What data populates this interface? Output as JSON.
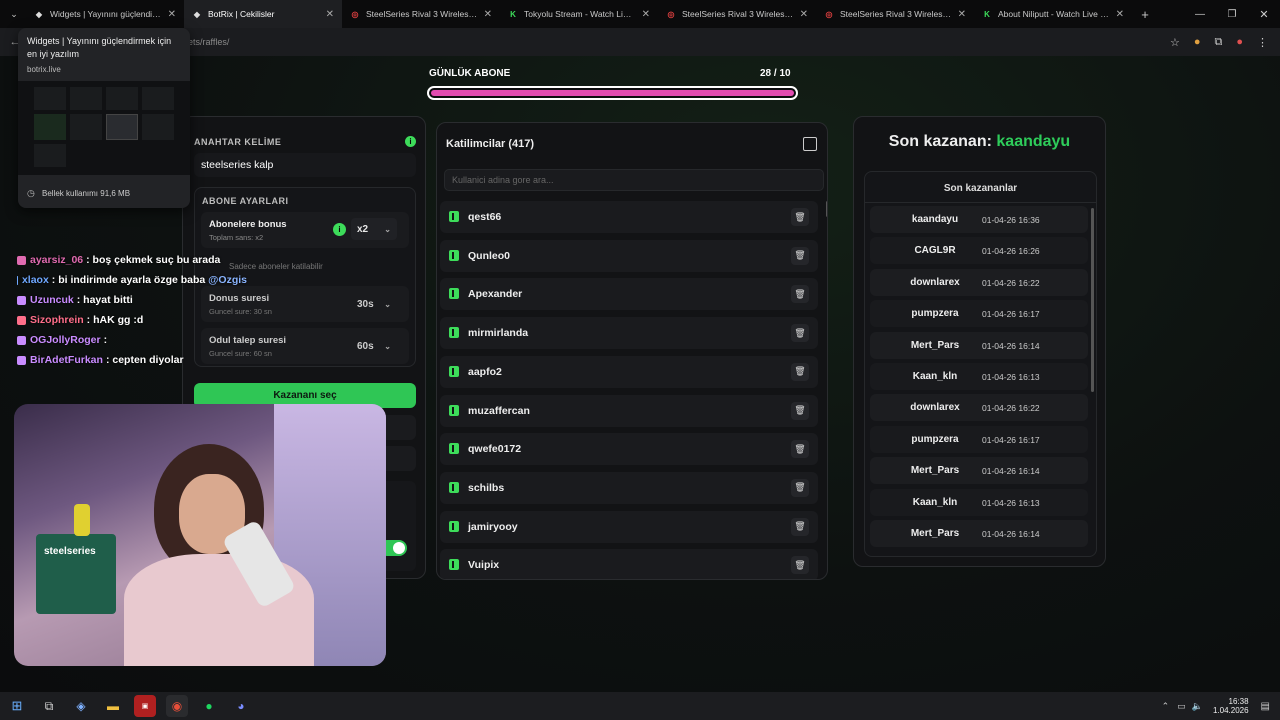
{
  "browser": {
    "tabs": [
      {
        "title": "Widgets | Yayınını güçlendirmek",
        "icon": "botrix-icon",
        "active": false
      },
      {
        "title": "BotRix | Cekilisler",
        "icon": "botrix-icon",
        "active": true
      },
      {
        "title": "SteelSeries Rival 3 Wireless Gen",
        "icon": "steelseries-icon",
        "active": false
      },
      {
        "title": "Tokyolu Stream - Watch Live on",
        "icon": "kick-icon",
        "active": false
      },
      {
        "title": "SteelSeries Rival 3 Wireless Gen",
        "icon": "steelseries-icon",
        "active": false
      },
      {
        "title": "SteelSeries Rival 3 Wireless Gen",
        "icon": "steelseries-icon",
        "active": false
      },
      {
        "title": "About Niliputt - Watch Live on",
        "icon": "kick-icon",
        "active": false
      }
    ],
    "url_visible": "ets/raffles/",
    "tooltip": {
      "title": "Widgets | Yayınını güçlendirmek için en iyi yazılım",
      "domain": "botrix.live",
      "memory": "Bellek kullanımı 91,6 MB"
    }
  },
  "goal": {
    "label": "GÜNLÜK ABONE",
    "count": "28 / 10",
    "progress": 1.0
  },
  "settings": {
    "keyword_label": "ANAHTAR KELİME",
    "keyword_value": "steelseries kalp",
    "sub_settings_label": "ABONE AYARLARI",
    "sub_bonus_label": "Abonelere bonus",
    "sub_bonus_sub": "Toplam sans: x2",
    "sub_bonus_value": "x2",
    "subs_only_label": "Sadece aboneler katilabilir",
    "bonus_time_label": "Donus suresi",
    "bonus_time_sub": "Guncel sure: 30 sn",
    "bonus_time_value": "30s",
    "claim_time_label": "Odul talep suresi",
    "claim_time_sub": "Guncel sure: 60 sn",
    "claim_time_value": "60s",
    "pick_winner_button": "Kazananı seç"
  },
  "participants": {
    "title": "Katilimcilar (417)",
    "search_placeholder": "Kullanici adina gore ara...",
    "items": [
      "qest66",
      "Qunleo0",
      "Apexander",
      "mirmirlanda",
      "aapfo2",
      "muzaffercan",
      "qwefe0172",
      "schilbs",
      "jamiryooy",
      "Vuipix"
    ]
  },
  "winners": {
    "last_winner_prefix": "Son kazanan:",
    "last_winner_name": "kaandayu",
    "list_title": "Son kazananlar",
    "items": [
      {
        "name": "kaandayu",
        "time": "01-04-26 16:36"
      },
      {
        "name": "CAGL9R",
        "time": "01-04-26 16:26"
      },
      {
        "name": "downlarex",
        "time": "01-04-26 16:22"
      },
      {
        "name": "pumpzera",
        "time": "01-04-26 16:17"
      },
      {
        "name": "Mert_Pars",
        "time": "01-04-26 16:14"
      },
      {
        "name": "Kaan_kln",
        "time": "01-04-26 16:13"
      },
      {
        "name": "downlarex",
        "time": "01-04-26 16:22"
      },
      {
        "name": "pumpzera",
        "time": "01-04-26 16:17"
      },
      {
        "name": "Mert_Pars",
        "time": "01-04-26 16:14"
      },
      {
        "name": "Kaan_kln",
        "time": "01-04-26 16:13"
      },
      {
        "name": "Mert_Pars",
        "time": "01-04-26 16:14"
      }
    ]
  },
  "chat": {
    "messages": [
      {
        "user": "ayarsiz_06",
        "text": ": boş çekmek suç bu arada",
        "color": "#e06bb0"
      },
      {
        "user": "xlaox",
        "text": ": bi indirimde ayarla özge baba ",
        "mention": "@Ozgis",
        "color": "#6fa8ff"
      },
      {
        "user": "Uzuncuk",
        "text": ": hayat bitti",
        "color": "#c98cff"
      },
      {
        "user": "Sizophrein",
        "text": ": hAK gg :d",
        "color": "#ff6f8a"
      },
      {
        "user": "OGJollyRoger",
        "text": ":",
        "color": "#c98cff"
      },
      {
        "user": "BirAdetFurkan",
        "text": ": cepten diyolar",
        "color": "#c98cff"
      }
    ]
  },
  "taskbar": {
    "time": "16:38",
    "date": "1.04.2026"
  },
  "colors": {
    "accent": "#3ddc5a",
    "winner": "#2ecc5a"
  }
}
